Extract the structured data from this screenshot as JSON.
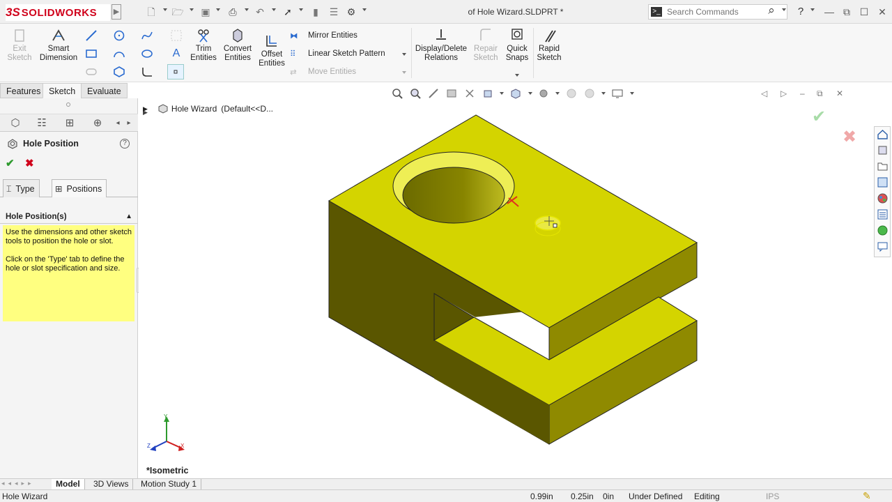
{
  "app": {
    "brand": "SOLIDWORKS",
    "brand_prefix": "3S",
    "document_title": "of Hole Wizard.SLDPRT *"
  },
  "search": {
    "placeholder": "Search Commands"
  },
  "toolbar": {
    "exit_sketch": "Exit Sketch",
    "smart_dimension": "Smart Dimension",
    "trim_entities": "Trim Entities",
    "convert_entities": "Convert Entities",
    "offset_entities": "Offset Entities",
    "mirror_entities": "Mirror Entities",
    "linear_sketch_pattern": "Linear Sketch Pattern",
    "move_entities": "Move Entities",
    "display_delete_relations": "Display/Delete Relations",
    "repair_sketch": "Repair Sketch",
    "quick_snaps": "Quick Snaps",
    "rapid_sketch": "Rapid Sketch"
  },
  "cm_tabs": [
    "Features",
    "Sketch",
    "Evaluate"
  ],
  "property_manager": {
    "title": "Hole Position",
    "tabs": {
      "type": "Type",
      "positions": "Positions"
    },
    "group": "Hole Position(s)",
    "message_1": "Use the dimensions and other sketch tools to position the hole or slot.",
    "message_2": "Click on the 'Type' tab to define the hole or slot specification and size."
  },
  "tree": {
    "part_name": "Hole Wizard",
    "config": "(Default<<D..."
  },
  "view": {
    "orientation": "*Isometric",
    "triad": {
      "x": "X",
      "y": "Y",
      "z": "Z"
    }
  },
  "bottom_tabs": [
    "Model",
    "3D Views",
    "Motion Study 1"
  ],
  "status": {
    "left": "Hole Wizard",
    "x": "0.99in",
    "y": "0.25in",
    "z": "0in",
    "sketch_state": "Under Defined",
    "mode": "Editing",
    "units": "IPS"
  },
  "colors": {
    "part": "#d4d400",
    "brand": "#d0021b",
    "message_bg": "#ffff80"
  }
}
